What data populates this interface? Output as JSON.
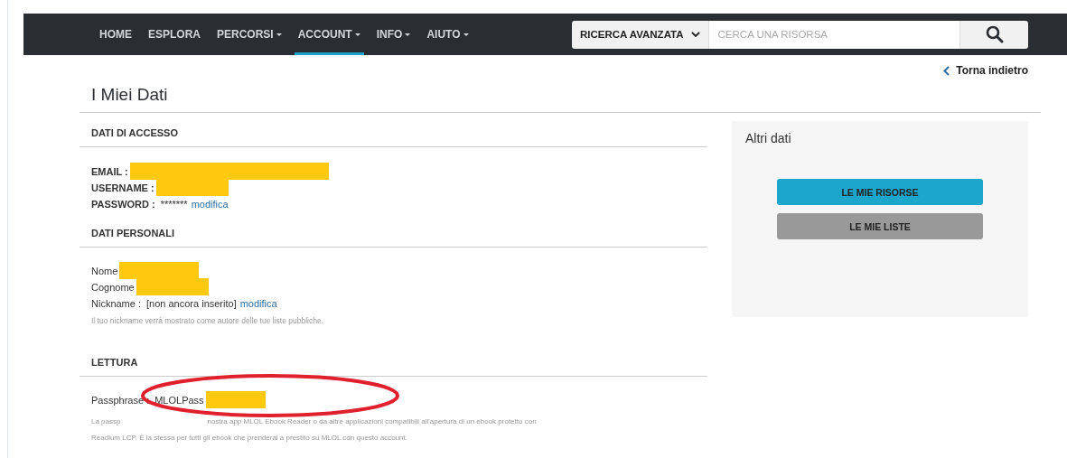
{
  "nav": {
    "items": [
      {
        "label": "HOME",
        "dropdown": false,
        "selected": false
      },
      {
        "label": "ESPLORA",
        "dropdown": false,
        "selected": false
      },
      {
        "label": "PERCORSI",
        "dropdown": true,
        "selected": false
      },
      {
        "label": "ACCOUNT",
        "dropdown": true,
        "selected": true
      },
      {
        "label": "INFO",
        "dropdown": true,
        "selected": false
      },
      {
        "label": "AIUTO",
        "dropdown": true,
        "selected": false
      }
    ],
    "search": {
      "scope": "RICERCA AVANZATA",
      "placeholder": "CERCA UNA RISORSA"
    }
  },
  "back_link": "Torna indietro",
  "page_title": "I Miei Dati",
  "sections": [
    {
      "title": "DATI DI ACCESSO",
      "bold_labels": true,
      "fields": [
        {
          "label": "EMAIL :",
          "redacted": true
        },
        {
          "label": "USERNAME :",
          "redacted": true
        },
        {
          "label": "PASSWORD :",
          "value": "*******",
          "link": "modifica",
          "redacted": false
        }
      ]
    },
    {
      "title": "DATI PERSONALI",
      "bold_labels": false,
      "fields": [
        {
          "label": "Nome",
          "redacted": true
        },
        {
          "label": "Cognome",
          "redacted": true
        },
        {
          "label": "Nickname :",
          "value": "[non ancora inserito]",
          "link": "modifica",
          "redacted": false
        }
      ],
      "note": "Il tuo nickname verrà mostrato come autore delle tue liste pubbliche."
    },
    {
      "title": "LETTURA",
      "bold_labels": false,
      "highlighted": true,
      "fields": [
        {
          "label": "Passphrase :",
          "value": "MLOLPass",
          "redacted": true
        }
      ],
      "note_parts": [
        "La passp",
        "nostra app MLOL Ebook Reader o da altre applicazioni compatibili all'apertura di un ebook protetto con",
        "Readium LCP. È la stessa per tutti gli ebook che prenderai a prestito su MLOL con questo account."
      ]
    }
  ],
  "side_panel": {
    "title": "Altri dati",
    "buttons": [
      {
        "label": "LE MIE RISORSE",
        "kind": "primary"
      },
      {
        "label": "LE MIE LISTE",
        "kind": "secondary"
      }
    ]
  }
}
